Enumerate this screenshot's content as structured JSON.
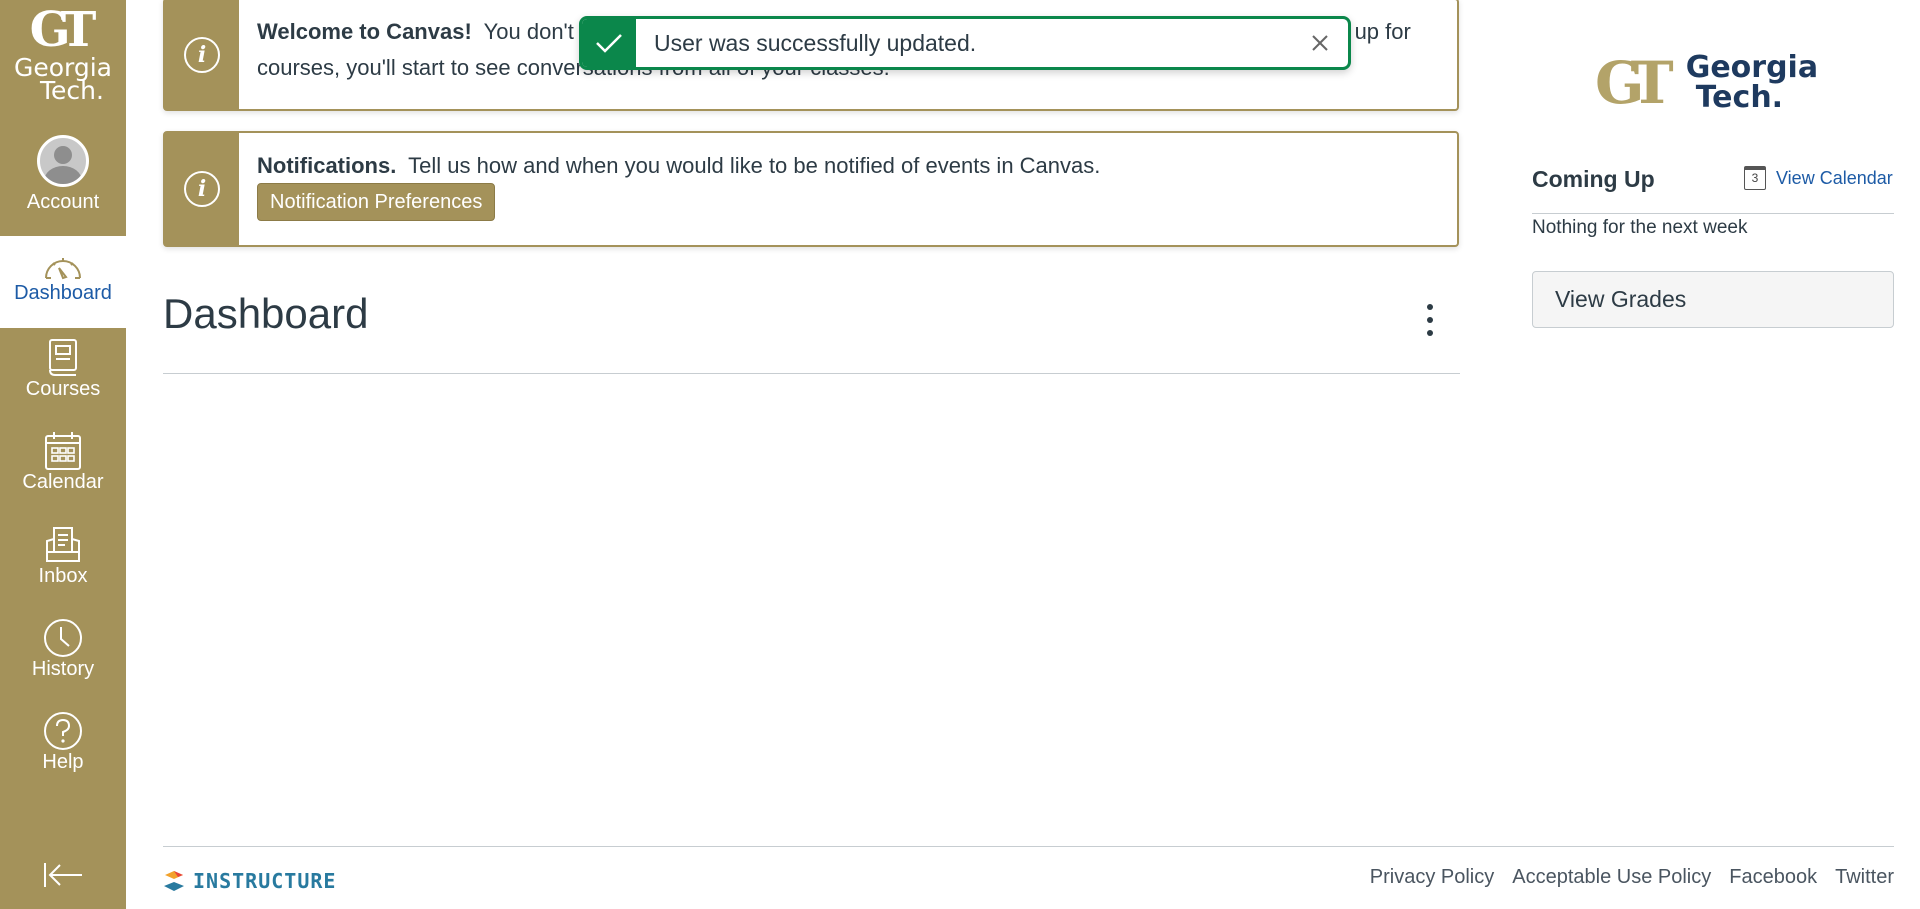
{
  "sidebar": {
    "logo": {
      "mark": "GT",
      "line1": "Georgia",
      "line2": "Tech."
    },
    "items": [
      {
        "id": "account",
        "label": "Account",
        "icon": "avatar-icon",
        "active": false
      },
      {
        "id": "dashboard",
        "label": "Dashboard",
        "icon": "dashboard-gauge-icon",
        "active": true
      },
      {
        "id": "courses",
        "label": "Courses",
        "icon": "book-icon",
        "active": false
      },
      {
        "id": "calendar",
        "label": "Calendar",
        "icon": "calendar-icon",
        "active": false
      },
      {
        "id": "inbox",
        "label": "Inbox",
        "icon": "inbox-icon",
        "active": false
      },
      {
        "id": "history",
        "label": "History",
        "icon": "clock-icon",
        "active": false
      },
      {
        "id": "help",
        "label": "Help",
        "icon": "question-circle-icon",
        "active": false
      }
    ],
    "collapse_icon": "collapse-arrow-icon"
  },
  "alerts": {
    "welcome": {
      "title": "Welcome to Canvas!",
      "body": "You don't have any messages to show in your stream yet. Once you've created or signed up for courses, you'll start to see conversations from all of your classes."
    },
    "notifications": {
      "title": "Notifications.",
      "body": "Tell us how and when you would like to be notified of events in Canvas.",
      "button_label": "Notification Preferences"
    }
  },
  "toast": {
    "message": "User was successfully updated.",
    "color": "#0b874b"
  },
  "main": {
    "title": "Dashboard"
  },
  "right": {
    "logo": {
      "mark": "GT",
      "line1": "Georgia",
      "line2": "Tech."
    },
    "coming_up": "Coming Up",
    "view_calendar": "View Calendar",
    "calendar_day": "3",
    "nothing": "Nothing for the next week",
    "view_grades": "View Grades"
  },
  "footer": {
    "brand": "INSTRUCTURE",
    "links": [
      "Privacy Policy",
      "Acceptable Use Policy",
      "Facebook",
      "Twitter"
    ]
  },
  "colors": {
    "brand_gold": "#a4925a",
    "link_blue": "#1d5ba6",
    "text": "#2d3b45"
  }
}
